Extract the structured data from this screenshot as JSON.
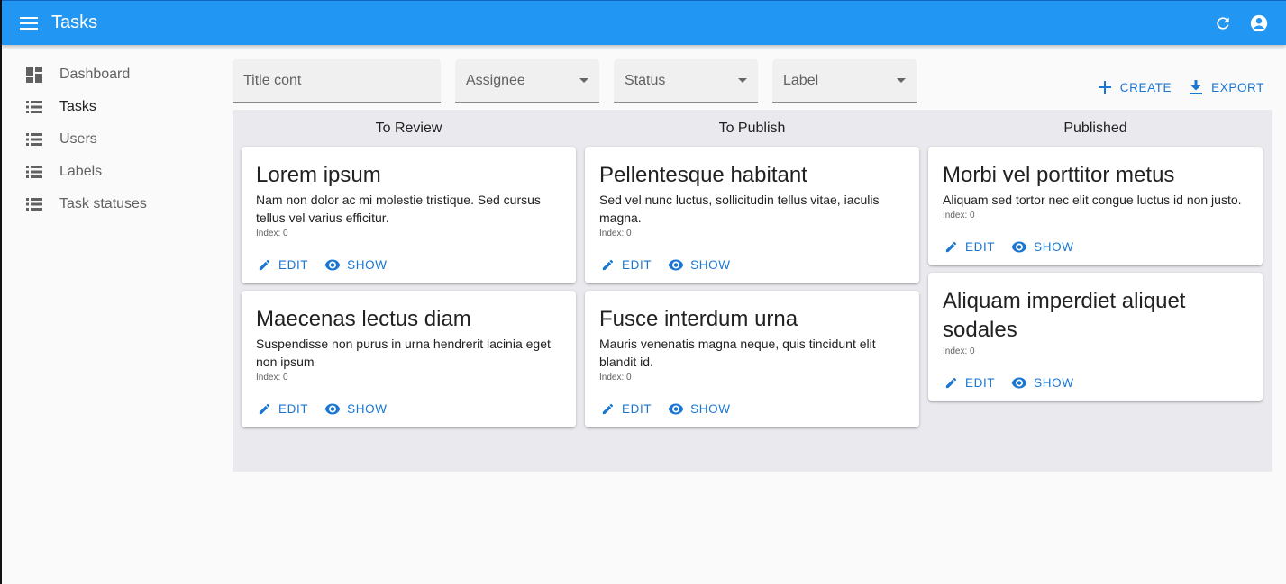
{
  "appbar": {
    "title": "Tasks",
    "bg_color": "#2196f3"
  },
  "sidebar": {
    "items": [
      {
        "label": "Dashboard",
        "icon": "dashboard-icon"
      },
      {
        "label": "Tasks",
        "icon": "list-icon",
        "active": true
      },
      {
        "label": "Users",
        "icon": "list-icon"
      },
      {
        "label": "Labels",
        "icon": "list-icon"
      },
      {
        "label": "Task statuses",
        "icon": "list-icon"
      }
    ]
  },
  "filters": {
    "title_placeholder": "Title cont",
    "assignee_label": "Assignee",
    "status_label": "Status",
    "label_label": "Label"
  },
  "actions": {
    "create_label": "CREATE",
    "export_label": "EXPORT"
  },
  "accent_color": "#1976d2",
  "board": {
    "columns": [
      {
        "title": "To Review",
        "cards": [
          {
            "title": "Lorem ipsum",
            "description": "Nam non dolor ac mi molestie tristique. Sed cursus tellus vel varius efficitur.",
            "index": "Index: 0",
            "edit": "EDIT",
            "show": "SHOW"
          },
          {
            "title": "Maecenas lectus diam",
            "description": "Suspendisse non purus in urna hendrerit lacinia eget non ipsum",
            "index": "Index: 0",
            "edit": "EDIT",
            "show": "SHOW"
          }
        ]
      },
      {
        "title": "To Publish",
        "cards": [
          {
            "title": "Pellentesque habitant",
            "description": "Sed vel nunc luctus, sollicitudin tellus vitae, iaculis magna.",
            "index": "Index: 0",
            "edit": "EDIT",
            "show": "SHOW"
          },
          {
            "title": "Fusce interdum urna",
            "description": "Mauris venenatis magna neque, quis tincidunt elit blandit id.",
            "index": "Index: 0",
            "edit": "EDIT",
            "show": "SHOW"
          }
        ]
      },
      {
        "title": "Published",
        "cards": [
          {
            "title": "Morbi vel porttitor metus",
            "description": "Aliquam sed tortor nec elit congue luctus id non justo.",
            "index": "Index: 0",
            "edit": "EDIT",
            "show": "SHOW"
          },
          {
            "title": "Aliquam imperdiet aliquet sodales",
            "description": "",
            "index": "Index: 0",
            "edit": "EDIT",
            "show": "SHOW"
          }
        ]
      }
    ]
  }
}
